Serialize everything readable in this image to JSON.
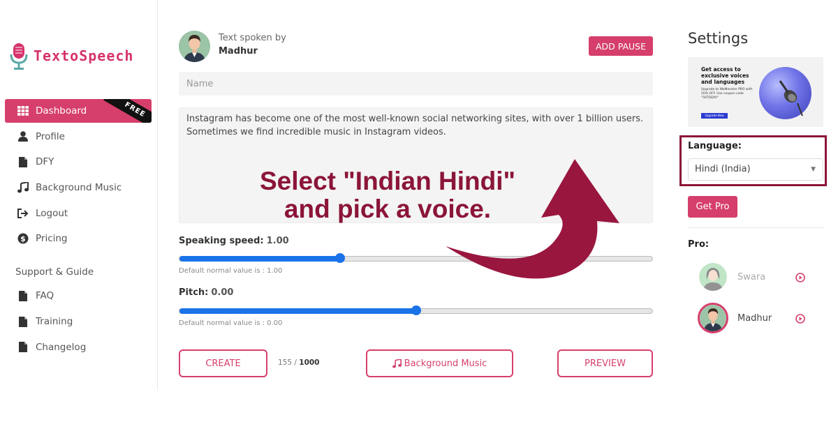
{
  "brand": {
    "name": "TextoSpeech"
  },
  "sidebar": {
    "items": [
      {
        "label": "Dashboard",
        "icon": "grid-icon",
        "active": true,
        "badge": "FREE"
      },
      {
        "label": "Profile",
        "icon": "user-icon"
      },
      {
        "label": "DFY",
        "icon": "file-icon"
      },
      {
        "label": "Background Music",
        "icon": "music-icon"
      },
      {
        "label": "Logout",
        "icon": "logout-icon"
      },
      {
        "label": "Pricing",
        "icon": "dollar-icon"
      }
    ],
    "support_heading": "Support & Guide",
    "support_items": [
      {
        "label": "FAQ",
        "icon": "file-icon"
      },
      {
        "label": "Training",
        "icon": "file-icon"
      },
      {
        "label": "Changelog",
        "icon": "file-icon"
      }
    ]
  },
  "main": {
    "spoken_by_label": "Text spoken by",
    "speaker_name": "Madhur",
    "add_pause_label": "ADD PAUSE",
    "name_placeholder": "Name",
    "text_content": "Instagram has become one of the most well-known social networking sites, with over 1 billion users. Sometimes we find incredible music in Instagram videos.",
    "speed": {
      "label": "Speaking speed:",
      "value": "1.00",
      "fraction": 0.34,
      "help": "Default normal value is : 1.00"
    },
    "pitch": {
      "label": "Pitch:",
      "value": "0.00",
      "fraction": 0.5,
      "help": "Default normal value is : 0.00"
    },
    "create_label": "CREATE",
    "char_count": "155",
    "char_limit": "1000",
    "bg_music_label": "Background Music",
    "preview_label": "PREVIEW"
  },
  "settings": {
    "title": "Settings",
    "promo": {
      "headline": "Get access to exclusive voices and languages",
      "sub": "Upgrade to WoMonster PRO with 50% OFF. Use coupon code \"50TODAY\"",
      "button": "Upgrade Now"
    },
    "language_label": "Language:",
    "language_value": "Hindi (India)",
    "get_pro_label": "Get Pro",
    "pro_label": "Pro:",
    "voices": [
      {
        "name": "Swara",
        "gender": "female",
        "disabled": true
      },
      {
        "name": "Madhur",
        "gender": "male",
        "selected": true
      }
    ]
  },
  "annotation": {
    "line1": "Select \"Indian Hindi\"",
    "line2": "and pick a voice."
  },
  "colors": {
    "accent": "#d63f6b",
    "annotation": "#8b1538",
    "slider": "#1a73e8"
  }
}
